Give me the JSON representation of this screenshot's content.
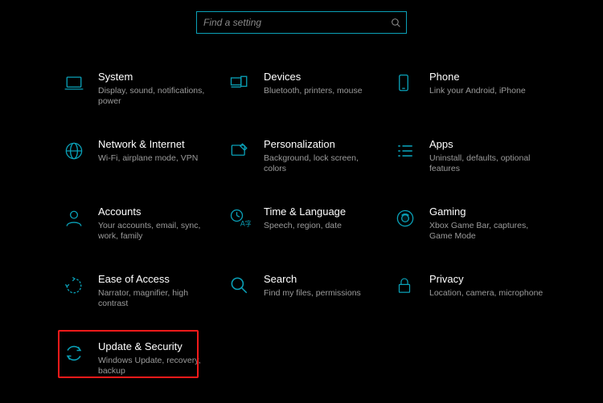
{
  "search": {
    "placeholder": "Find a setting"
  },
  "tiles": [
    {
      "id": "system",
      "title": "System",
      "desc": "Display, sound, notifications, power"
    },
    {
      "id": "devices",
      "title": "Devices",
      "desc": "Bluetooth, printers, mouse"
    },
    {
      "id": "phone",
      "title": "Phone",
      "desc": "Link your Android, iPhone"
    },
    {
      "id": "network",
      "title": "Network & Internet",
      "desc": "Wi-Fi, airplane mode, VPN"
    },
    {
      "id": "personalization",
      "title": "Personalization",
      "desc": "Background, lock screen, colors"
    },
    {
      "id": "apps",
      "title": "Apps",
      "desc": "Uninstall, defaults, optional features"
    },
    {
      "id": "accounts",
      "title": "Accounts",
      "desc": "Your accounts, email, sync, work, family"
    },
    {
      "id": "time-language",
      "title": "Time & Language",
      "desc": "Speech, region, date"
    },
    {
      "id": "gaming",
      "title": "Gaming",
      "desc": "Xbox Game Bar, captures, Game Mode"
    },
    {
      "id": "ease-of-access",
      "title": "Ease of Access",
      "desc": "Narrator, magnifier, high contrast"
    },
    {
      "id": "search",
      "title": "Search",
      "desc": "Find my files, permissions"
    },
    {
      "id": "privacy",
      "title": "Privacy",
      "desc": "Location, camera, microphone"
    },
    {
      "id": "update-security",
      "title": "Update & Security",
      "desc": "Windows Update, recovery, backup"
    }
  ]
}
